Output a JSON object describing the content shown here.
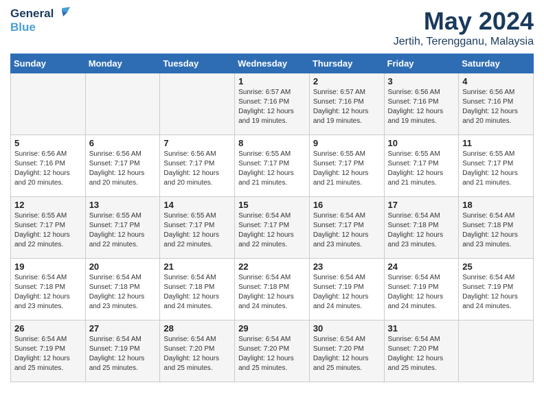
{
  "header": {
    "logo_line1": "General",
    "logo_line2": "Blue",
    "month_title": "May 2024",
    "location": "Jertih, Terengganu, Malaysia"
  },
  "days_of_week": [
    "Sunday",
    "Monday",
    "Tuesday",
    "Wednesday",
    "Thursday",
    "Friday",
    "Saturday"
  ],
  "weeks": [
    [
      {
        "day": "",
        "info": ""
      },
      {
        "day": "",
        "info": ""
      },
      {
        "day": "",
        "info": ""
      },
      {
        "day": "1",
        "info": "Sunrise: 6:57 AM\nSunset: 7:16 PM\nDaylight: 12 hours\nand 19 minutes."
      },
      {
        "day": "2",
        "info": "Sunrise: 6:57 AM\nSunset: 7:16 PM\nDaylight: 12 hours\nand 19 minutes."
      },
      {
        "day": "3",
        "info": "Sunrise: 6:56 AM\nSunset: 7:16 PM\nDaylight: 12 hours\nand 19 minutes."
      },
      {
        "day": "4",
        "info": "Sunrise: 6:56 AM\nSunset: 7:16 PM\nDaylight: 12 hours\nand 20 minutes."
      }
    ],
    [
      {
        "day": "5",
        "info": "Sunrise: 6:56 AM\nSunset: 7:16 PM\nDaylight: 12 hours\nand 20 minutes."
      },
      {
        "day": "6",
        "info": "Sunrise: 6:56 AM\nSunset: 7:17 PM\nDaylight: 12 hours\nand 20 minutes."
      },
      {
        "day": "7",
        "info": "Sunrise: 6:56 AM\nSunset: 7:17 PM\nDaylight: 12 hours\nand 20 minutes."
      },
      {
        "day": "8",
        "info": "Sunrise: 6:55 AM\nSunset: 7:17 PM\nDaylight: 12 hours\nand 21 minutes."
      },
      {
        "day": "9",
        "info": "Sunrise: 6:55 AM\nSunset: 7:17 PM\nDaylight: 12 hours\nand 21 minutes."
      },
      {
        "day": "10",
        "info": "Sunrise: 6:55 AM\nSunset: 7:17 PM\nDaylight: 12 hours\nand 21 minutes."
      },
      {
        "day": "11",
        "info": "Sunrise: 6:55 AM\nSunset: 7:17 PM\nDaylight: 12 hours\nand 21 minutes."
      }
    ],
    [
      {
        "day": "12",
        "info": "Sunrise: 6:55 AM\nSunset: 7:17 PM\nDaylight: 12 hours\nand 22 minutes."
      },
      {
        "day": "13",
        "info": "Sunrise: 6:55 AM\nSunset: 7:17 PM\nDaylight: 12 hours\nand 22 minutes."
      },
      {
        "day": "14",
        "info": "Sunrise: 6:55 AM\nSunset: 7:17 PM\nDaylight: 12 hours\nand 22 minutes."
      },
      {
        "day": "15",
        "info": "Sunrise: 6:54 AM\nSunset: 7:17 PM\nDaylight: 12 hours\nand 22 minutes."
      },
      {
        "day": "16",
        "info": "Sunrise: 6:54 AM\nSunset: 7:17 PM\nDaylight: 12 hours\nand 23 minutes."
      },
      {
        "day": "17",
        "info": "Sunrise: 6:54 AM\nSunset: 7:18 PM\nDaylight: 12 hours\nand 23 minutes."
      },
      {
        "day": "18",
        "info": "Sunrise: 6:54 AM\nSunset: 7:18 PM\nDaylight: 12 hours\nand 23 minutes."
      }
    ],
    [
      {
        "day": "19",
        "info": "Sunrise: 6:54 AM\nSunset: 7:18 PM\nDaylight: 12 hours\nand 23 minutes."
      },
      {
        "day": "20",
        "info": "Sunrise: 6:54 AM\nSunset: 7:18 PM\nDaylight: 12 hours\nand 23 minutes."
      },
      {
        "day": "21",
        "info": "Sunrise: 6:54 AM\nSunset: 7:18 PM\nDaylight: 12 hours\nand 24 minutes."
      },
      {
        "day": "22",
        "info": "Sunrise: 6:54 AM\nSunset: 7:18 PM\nDaylight: 12 hours\nand 24 minutes."
      },
      {
        "day": "23",
        "info": "Sunrise: 6:54 AM\nSunset: 7:19 PM\nDaylight: 12 hours\nand 24 minutes."
      },
      {
        "day": "24",
        "info": "Sunrise: 6:54 AM\nSunset: 7:19 PM\nDaylight: 12 hours\nand 24 minutes."
      },
      {
        "day": "25",
        "info": "Sunrise: 6:54 AM\nSunset: 7:19 PM\nDaylight: 12 hours\nand 24 minutes."
      }
    ],
    [
      {
        "day": "26",
        "info": "Sunrise: 6:54 AM\nSunset: 7:19 PM\nDaylight: 12 hours\nand 25 minutes."
      },
      {
        "day": "27",
        "info": "Sunrise: 6:54 AM\nSunset: 7:19 PM\nDaylight: 12 hours\nand 25 minutes."
      },
      {
        "day": "28",
        "info": "Sunrise: 6:54 AM\nSunset: 7:20 PM\nDaylight: 12 hours\nand 25 minutes."
      },
      {
        "day": "29",
        "info": "Sunrise: 6:54 AM\nSunset: 7:20 PM\nDaylight: 12 hours\nand 25 minutes."
      },
      {
        "day": "30",
        "info": "Sunrise: 6:54 AM\nSunset: 7:20 PM\nDaylight: 12 hours\nand 25 minutes."
      },
      {
        "day": "31",
        "info": "Sunrise: 6:54 AM\nSunset: 7:20 PM\nDaylight: 12 hours\nand 25 minutes."
      },
      {
        "day": "",
        "info": ""
      }
    ]
  ]
}
